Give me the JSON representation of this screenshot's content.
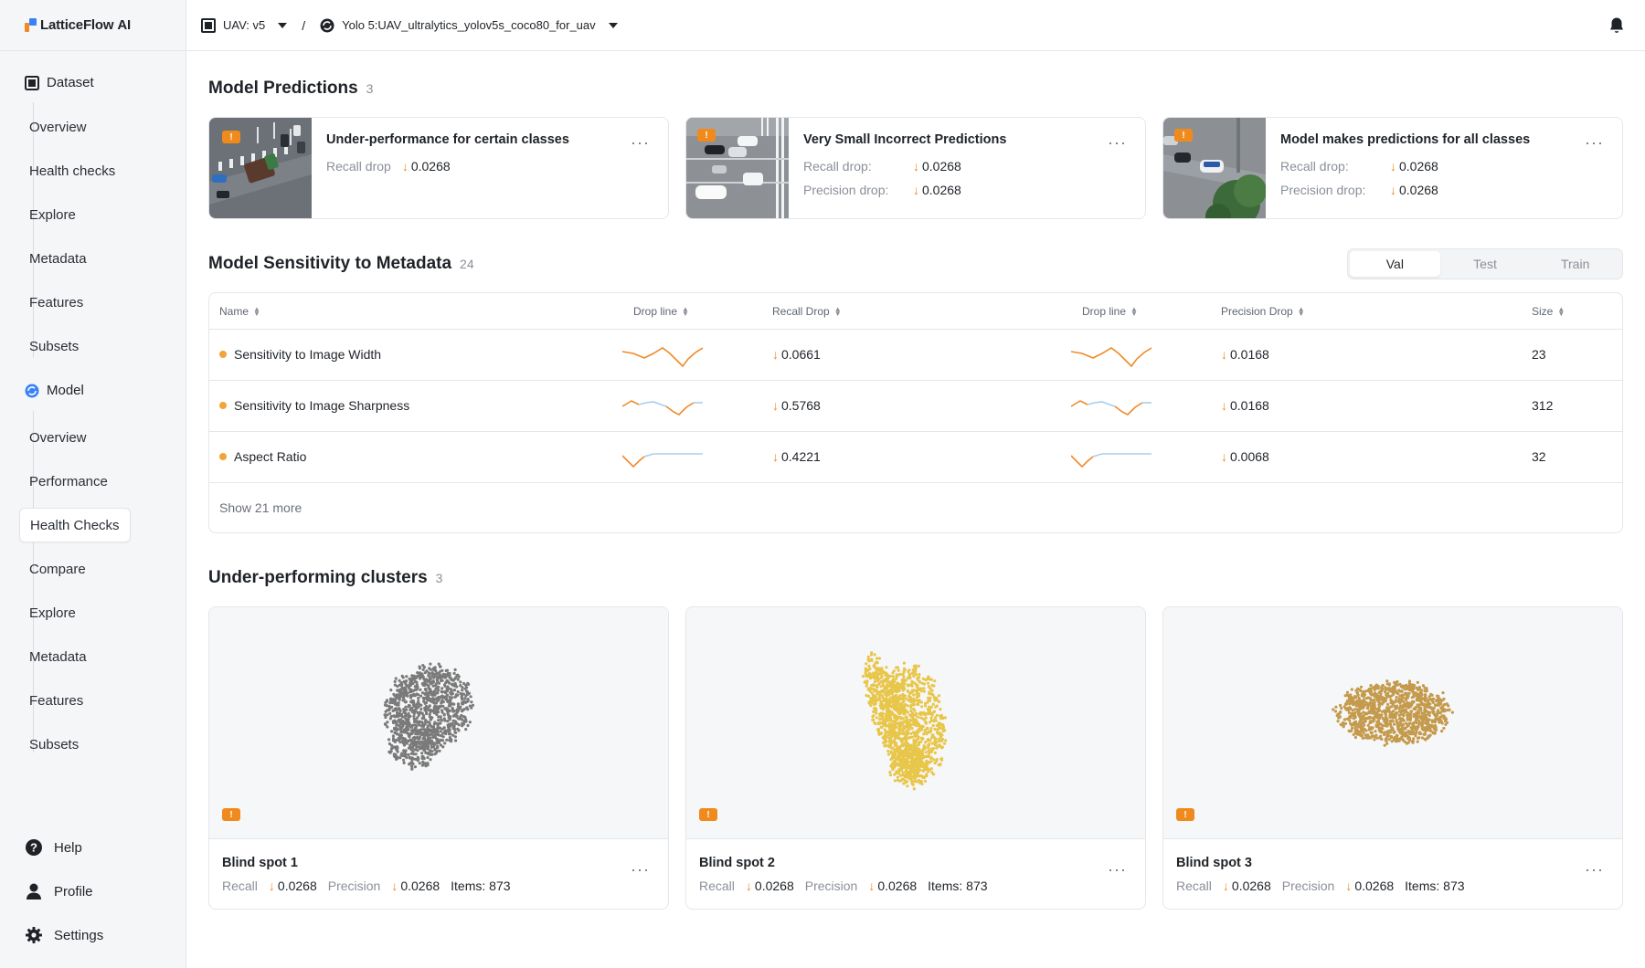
{
  "app": {
    "logo_text": "LatticeFlow",
    "logo_ai": "AI"
  },
  "sidebar": {
    "dataset": {
      "label": "Dataset",
      "items": [
        "Overview",
        "Health checks",
        "Explore",
        "Metadata",
        "Features",
        "Subsets"
      ]
    },
    "model": {
      "label": "Model",
      "items": [
        "Overview",
        "Performance",
        "Health Checks",
        "Compare",
        "Explore",
        "Metadata",
        "Features",
        "Subsets"
      ],
      "active": "Health Checks"
    },
    "bottom": {
      "help": "Help",
      "profile": "Profile",
      "settings": "Settings"
    }
  },
  "topbar": {
    "dataset": "UAV: v5",
    "separator": "/",
    "model": "Yolo 5:UAV_ultralytics_yolov5s_coco80_for_uav"
  },
  "predictions": {
    "title": "Model Predictions",
    "count": "3",
    "warn_glyph": "!",
    "cards": [
      {
        "title": "Under-performance for certain classes",
        "rows": [
          {
            "label": "Recall drop",
            "value": "0.0268"
          }
        ]
      },
      {
        "title": "Very Small Incorrect Predictions",
        "rows": [
          {
            "label": "Recall drop:",
            "value": "0.0268"
          },
          {
            "label": "Precision drop:",
            "value": "0.0268"
          }
        ]
      },
      {
        "title": "Model makes predictions for all classes",
        "rows": [
          {
            "label": "Recall drop:",
            "value": "0.0268"
          },
          {
            "label": "Precision drop:",
            "value": "0.0268"
          }
        ]
      }
    ]
  },
  "sensitivity": {
    "title": "Model Sensitivity to Metadata",
    "count": "24",
    "tabs": [
      "Val",
      "Test",
      "Train"
    ],
    "active_tab": "Val",
    "columns": [
      "Name",
      "Drop line",
      "Recall Drop",
      "Drop line",
      "Precision Drop",
      "Size"
    ],
    "rows": [
      {
        "name": "Sensitivity to Image Width",
        "recall_drop": "0.0661",
        "precision_drop": "0.0168",
        "size": "23"
      },
      {
        "name": "Sensitivity to Image Sharpness",
        "recall_drop": "0.5768",
        "precision_drop": "0.0168",
        "size": "312"
      },
      {
        "name": "Aspect Ratio",
        "recall_drop": "0.4221",
        "precision_drop": "0.0068",
        "size": "32"
      }
    ],
    "show_more": "Show 21 more"
  },
  "clusters": {
    "title": "Under-performing clusters",
    "count": "3",
    "items": [
      {
        "title": "Blind spot 1",
        "recall_label": "Recall",
        "recall": "0.0268",
        "precision_label": "Precision",
        "precision": "0.0268",
        "items": "Items: 873",
        "color": "#7a7a7a"
      },
      {
        "title": "Blind spot 2",
        "recall_label": "Recall",
        "recall": "0.0268",
        "precision_label": "Precision",
        "precision": "0.0268",
        "items": "Items: 873",
        "color": "#e8c64a"
      },
      {
        "title": "Blind spot 3",
        "recall_label": "Recall",
        "recall": "0.0268",
        "precision_label": "Precision",
        "precision": "0.0268",
        "items": "Items: 873",
        "color": "#c49a4c"
      }
    ]
  },
  "colors": {
    "accent_orange": "#ef8a2a",
    "warn_badge": "#f08a1c",
    "spark_blue": "#a9cdf0"
  },
  "icons": {
    "more": "more-horizontal-icon",
    "down": "arrow-down-icon",
    "bell": "bell-icon"
  }
}
